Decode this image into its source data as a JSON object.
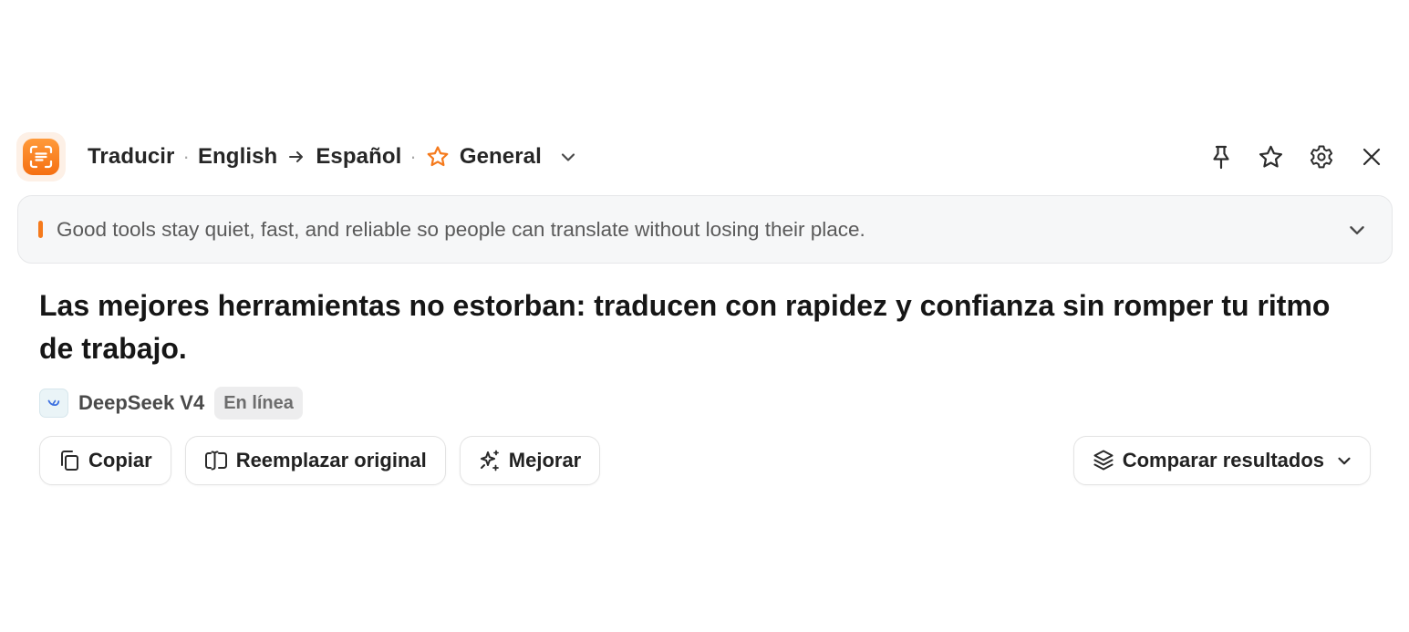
{
  "header": {
    "mode": "Traducir",
    "separator": "·",
    "source_language": "English",
    "target_language": "Español",
    "style": "General",
    "icons": [
      "app-logo-icon",
      "arrow-right-icon",
      "star-icon",
      "chevron-down-icon",
      "pin-icon",
      "star-icon",
      "gear-icon",
      "close-icon"
    ]
  },
  "source": {
    "text": "Good tools stay quiet, fast, and reliable so people can translate without losing their place."
  },
  "result": {
    "text": "Las mejores herramientas no estorban: traducen con rapidez y confianza sin romper tu ritmo de trabajo."
  },
  "model": {
    "name": "DeepSeek V4",
    "status": "En línea"
  },
  "actions": {
    "copy_label": "Copiar",
    "replace_label": "Reemplazar original",
    "improve_label": "Mejorar",
    "compare_label": "Comparar resultados"
  },
  "colors": {
    "accent": "#f57a1c",
    "source_bg": "#f6f7f8",
    "text": "#161616"
  }
}
